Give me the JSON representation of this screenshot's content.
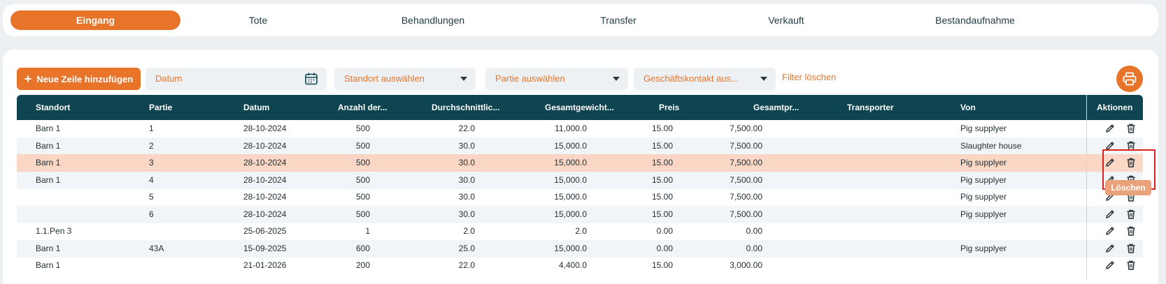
{
  "tabs": [
    {
      "label": "Eingang",
      "active": true
    },
    {
      "label": "Tote"
    },
    {
      "label": "Behandlungen"
    },
    {
      "label": "Transfer"
    },
    {
      "label": "Verkauft"
    },
    {
      "label": "Bestandaufnahme"
    }
  ],
  "toolbar": {
    "add_label": "Neue Zeile hinzufügen",
    "date_placeholder": "Datum",
    "location_placeholder": "Standort auswählen",
    "batch_placeholder": "Partie auswählen",
    "contact_placeholder": "Geschäftskontakt aus...",
    "clear_filter": "Filter löschen"
  },
  "table": {
    "columns": [
      "Standort",
      "Partie",
      "Datum",
      "Anzahl der...",
      "Durchschnittlic...",
      "Gesamtgewicht...",
      "Preis",
      "Gesamtpr...",
      "Transporter",
      "Von",
      "Aktionen"
    ],
    "rows": [
      {
        "standort": "Barn 1",
        "partie": "1",
        "datum": "28-10-2024",
        "anzahl": "500",
        "durchschnitt": "22.0",
        "gesamtgewicht": "11,000.0",
        "preis": "15.00",
        "gesamtpreis": "7,500.00",
        "transporter": "",
        "von": "Pig supplyer"
      },
      {
        "standort": "Barn 1",
        "partie": "2",
        "datum": "28-10-2024",
        "anzahl": "500",
        "durchschnitt": "30.0",
        "gesamtgewicht": "15,000.0",
        "preis": "15.00",
        "gesamtpreis": "7,500.00",
        "transporter": "",
        "von": "Slaughter house"
      },
      {
        "standort": "Barn 1",
        "partie": "3",
        "datum": "28-10-2024",
        "anzahl": "500",
        "durchschnitt": "30.0",
        "gesamtgewicht": "15,000.0",
        "preis": "15.00",
        "gesamtpreis": "7,500.00",
        "transporter": "",
        "von": "Pig supplyer"
      },
      {
        "standort": "Barn 1",
        "partie": "4",
        "datum": "28-10-2024",
        "anzahl": "500",
        "durchschnitt": "30.0",
        "gesamtgewicht": "15,000.0",
        "preis": "15.00",
        "gesamtpreis": "7,500.00",
        "transporter": "",
        "von": "Pig supplyer"
      },
      {
        "standort": "",
        "partie": "5",
        "datum": "28-10-2024",
        "anzahl": "500",
        "durchschnitt": "30.0",
        "gesamtgewicht": "15,000.0",
        "preis": "15.00",
        "gesamtpreis": "7,500.00",
        "transporter": "",
        "von": "Pig supplyer"
      },
      {
        "standort": "",
        "partie": "6",
        "datum": "28-10-2024",
        "anzahl": "500",
        "durchschnitt": "30.0",
        "gesamtgewicht": "15,000.0",
        "preis": "15.00",
        "gesamtpreis": "7,500.00",
        "transporter": "",
        "von": "Pig supplyer"
      },
      {
        "standort": "1.1.Pen 3",
        "partie": "",
        "datum": "25-06-2025",
        "anzahl": "1",
        "durchschnitt": "2.0",
        "gesamtgewicht": "2.0",
        "preis": "0.00",
        "gesamtpreis": "0.00",
        "transporter": "",
        "von": ""
      },
      {
        "standort": "Barn 1",
        "partie": "43A",
        "datum": "15-09-2025",
        "anzahl": "600",
        "durchschnitt": "25.0",
        "gesamtgewicht": "15,000.0",
        "preis": "0.00",
        "gesamtpreis": "0.00",
        "transporter": "",
        "von": "Pig supplyer"
      },
      {
        "standort": "Barn 1",
        "partie": "",
        "datum": "21-01-2026",
        "anzahl": "200",
        "durchschnitt": "22.0",
        "gesamtgewicht": "4,400.0",
        "preis": "15.00",
        "gesamtpreis": "3,000.00",
        "transporter": "",
        "von": ""
      }
    ]
  },
  "tooltip": {
    "label": "Löschen"
  },
  "colors": {
    "accent": "#e8742a",
    "header": "#0e4550",
    "highlight_row": "#f9d7c4"
  },
  "icons": [
    "plus-icon",
    "calendar-icon",
    "chevron-down-icon",
    "printer-icon",
    "pencil-icon",
    "trash-icon"
  ]
}
